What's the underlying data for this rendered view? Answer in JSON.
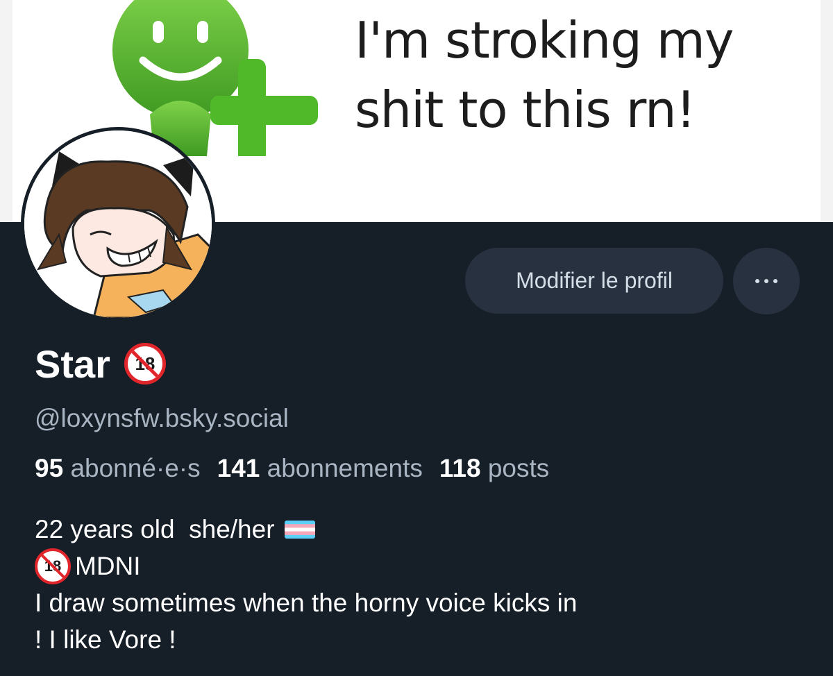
{
  "banner": {
    "caption_line1": "I'm stroking my",
    "caption_line2": "shit to this rn!"
  },
  "actions": {
    "edit_label": "Modifier le profil",
    "more_icon": "ellipsis-icon"
  },
  "profile": {
    "display_name": "Star",
    "badge_text": "18",
    "handle": "@loxynsfw.bsky.social",
    "stats": {
      "followers_count": "95",
      "followers_label": "abonné·e·s",
      "following_count": "141",
      "following_label": "abonnements",
      "posts_count": "118",
      "posts_label": "posts"
    },
    "bio": {
      "line1": "22 years old  she/her",
      "line2_badge": "18",
      "line2": "MDNI",
      "line3": "I draw sometimes when the horny voice kicks in",
      "line4": "! I like Vore !"
    }
  },
  "colors": {
    "background": "#161e27",
    "button": "#273140",
    "muted_text": "#a9b5c3",
    "accent_green": "#56b52f",
    "ban_red": "#e0262b"
  }
}
